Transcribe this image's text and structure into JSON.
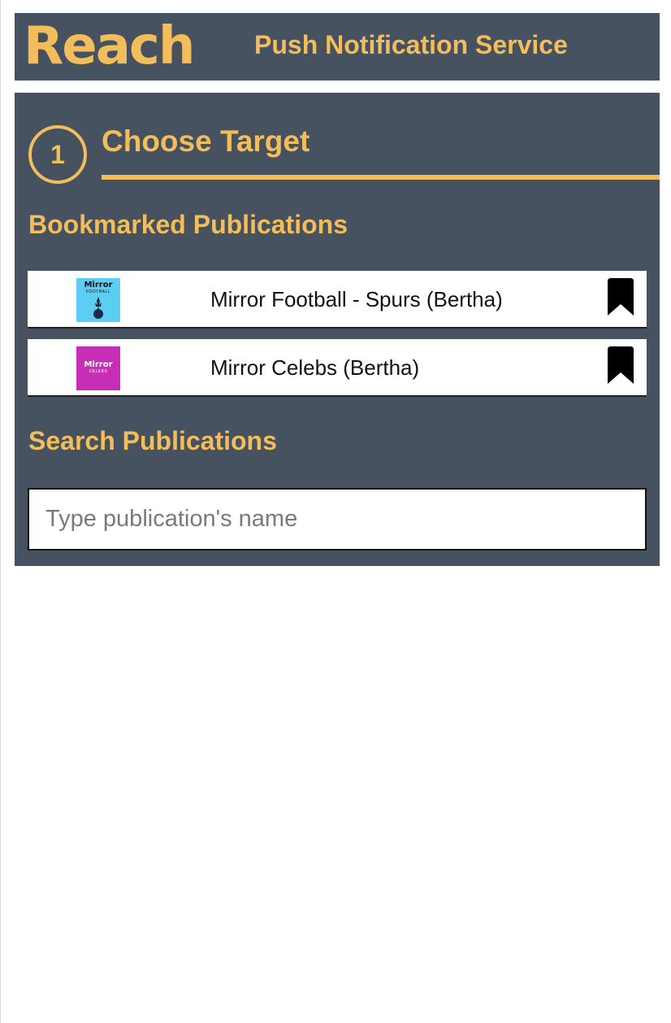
{
  "header": {
    "logo": "Reach",
    "title": "Push Notification Service"
  },
  "step": {
    "number": "1",
    "title": "Choose Target"
  },
  "bookmarked": {
    "heading": "Bookmarked Publications",
    "items": [
      {
        "name": "Mirror Football - Spurs (Bertha)",
        "logo_brand": "Mirror",
        "logo_sub": "FOOTBALL",
        "logo_bg": "#5dcdf3",
        "icon": "bookmark-icon"
      },
      {
        "name": "Mirror Celebs (Bertha)",
        "logo_brand": "Mirror",
        "logo_sub": "CELEBS",
        "logo_bg": "#c62fb5",
        "icon": "bookmark-icon"
      }
    ]
  },
  "search": {
    "heading": "Search Publications",
    "placeholder": "Type publication's name",
    "value": ""
  },
  "colors": {
    "panel_bg": "#465260",
    "accent": "#f2bd5a"
  }
}
